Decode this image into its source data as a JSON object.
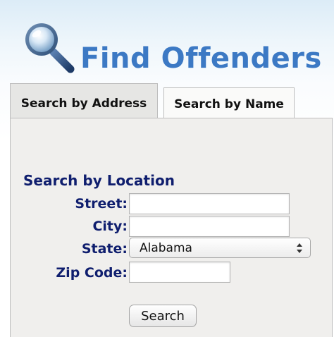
{
  "header": {
    "title": "Find Offenders",
    "icon": "magnifying-glass-icon"
  },
  "tabs": [
    {
      "label": "Search by Address",
      "state": "inactive"
    },
    {
      "label": "Search by Name",
      "state": "active"
    }
  ],
  "form": {
    "section_title": "Search by Location",
    "street": {
      "label": "Street:",
      "value": ""
    },
    "city": {
      "label": "City:",
      "value": ""
    },
    "state": {
      "label": "State:",
      "value": "Alabama"
    },
    "zip": {
      "label": "Zip Code:",
      "value": ""
    },
    "submit_label": "Search"
  },
  "colors": {
    "title_blue": "#3c79c4",
    "label_navy": "#0f1e6e",
    "panel_bg": "#f0efed"
  }
}
